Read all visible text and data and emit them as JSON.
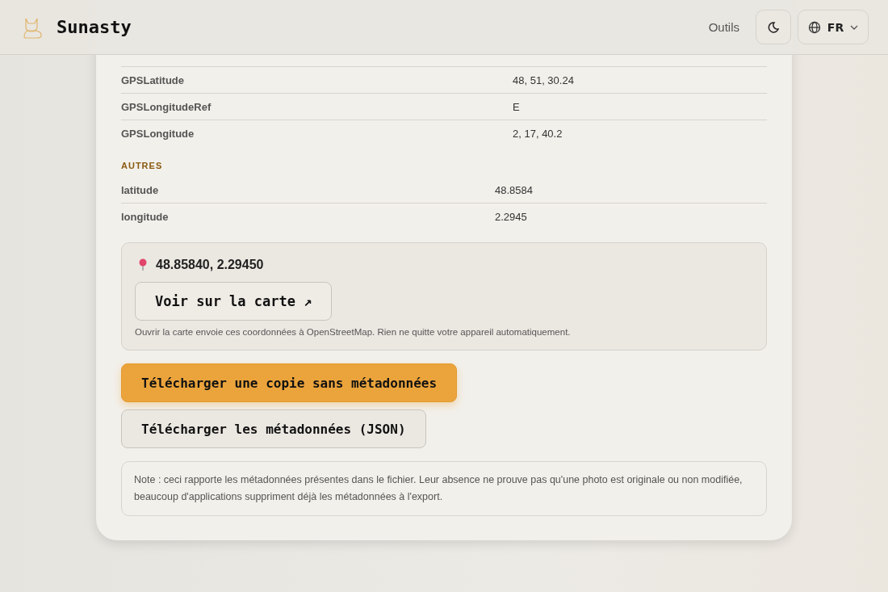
{
  "header": {
    "brand": "Sunasty",
    "nav_link": "Outils",
    "language": "FR"
  },
  "gps_rows": [
    {
      "key": "GPSLatitude",
      "value": "48, 51, 30.24"
    },
    {
      "key": "GPSLongitudeRef",
      "value": "E"
    },
    {
      "key": "GPSLongitude",
      "value": "2, 17, 40.2"
    }
  ],
  "other_section": {
    "title": "AUTRES",
    "rows": [
      {
        "key": "latitude",
        "value": "48.8584"
      },
      {
        "key": "longitude",
        "value": "2.2945"
      }
    ]
  },
  "location": {
    "coordinates": "48.85840, 2.29450",
    "map_button": "Voir sur la carte ↗",
    "notice": "Ouvrir la carte envoie ces coordonnées à OpenStreetMap. Rien ne quitte votre appareil automatiquement."
  },
  "actions": [
    {
      "label": "Télécharger une copie sans métadonnées",
      "kind": "primary"
    },
    {
      "label": "Télécharger les métadonnées (JSON)",
      "kind": "secondary"
    }
  ],
  "note": "Note : ceci rapporte les métadonnées présentes dans le fichier. Leur absence ne prouve pas qu'une photo est originale ou non modifiée, beaucoup d'applications suppriment déjà les métadonnées à l'export."
}
